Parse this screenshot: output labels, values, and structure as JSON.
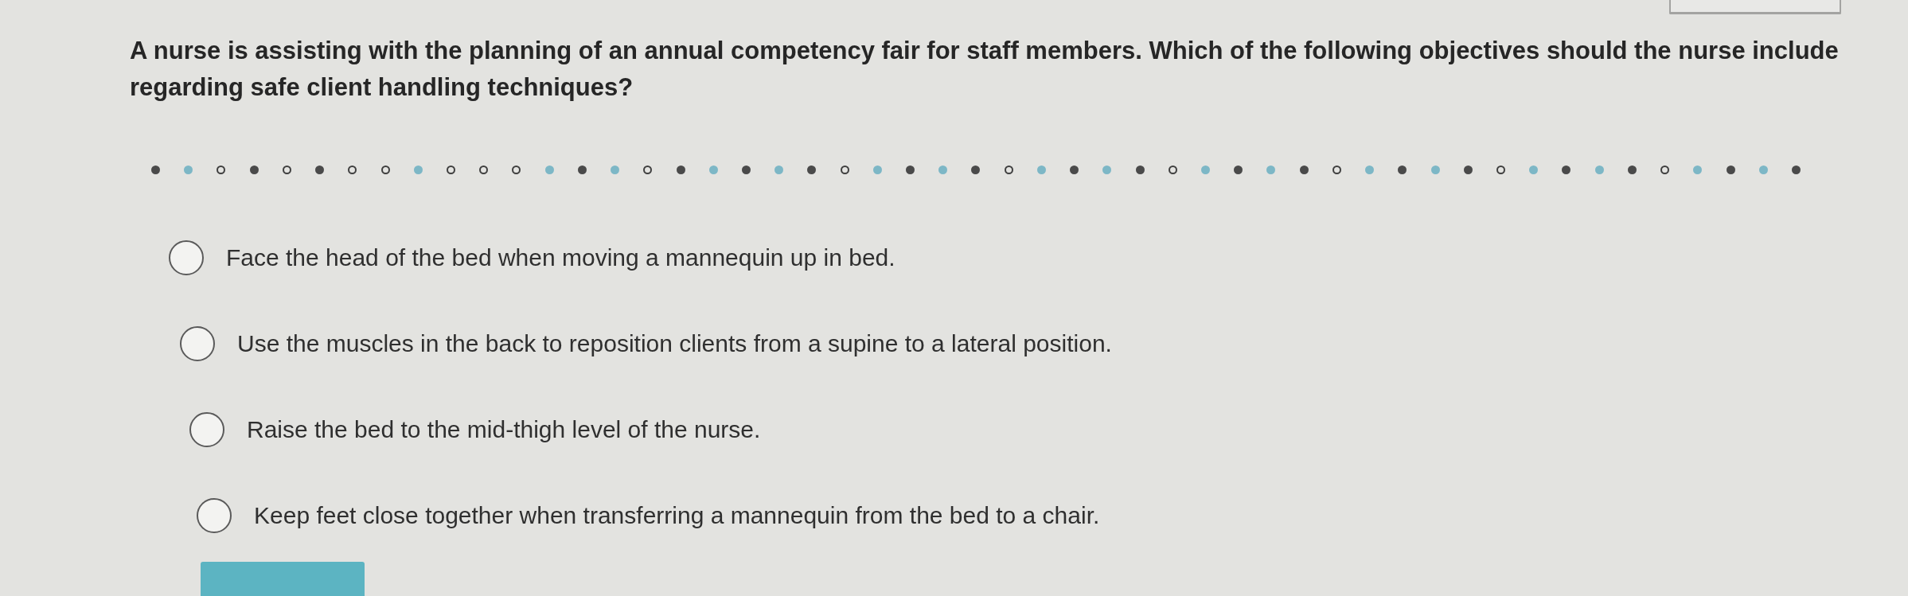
{
  "question": {
    "text": "A nurse is assisting with the planning of an annual competency fair for staff members. Which of the following objectives should the nurse include regarding safe client handling techniques?"
  },
  "progress_dots": [
    {
      "kind": "filled"
    },
    {
      "kind": "tinted"
    },
    {
      "kind": "hollow"
    },
    {
      "kind": "filled"
    },
    {
      "kind": "hollow"
    },
    {
      "kind": "filled"
    },
    {
      "kind": "hollow"
    },
    {
      "kind": "hollow"
    },
    {
      "kind": "tinted"
    },
    {
      "kind": "hollow"
    },
    {
      "kind": "hollow"
    },
    {
      "kind": "hollow"
    },
    {
      "kind": "tinted"
    },
    {
      "kind": "filled"
    },
    {
      "kind": "tinted"
    },
    {
      "kind": "hollow"
    },
    {
      "kind": "filled"
    },
    {
      "kind": "tinted"
    },
    {
      "kind": "filled"
    },
    {
      "kind": "tinted"
    },
    {
      "kind": "filled"
    },
    {
      "kind": "hollow"
    },
    {
      "kind": "tinted"
    },
    {
      "kind": "filled"
    },
    {
      "kind": "tinted"
    },
    {
      "kind": "filled"
    },
    {
      "kind": "hollow"
    },
    {
      "kind": "tinted"
    },
    {
      "kind": "filled"
    },
    {
      "kind": "tinted"
    },
    {
      "kind": "filled"
    },
    {
      "kind": "hollow"
    },
    {
      "kind": "tinted"
    },
    {
      "kind": "filled"
    },
    {
      "kind": "tinted"
    },
    {
      "kind": "filled"
    },
    {
      "kind": "hollow"
    },
    {
      "kind": "tinted"
    },
    {
      "kind": "filled"
    },
    {
      "kind": "tinted"
    },
    {
      "kind": "filled"
    },
    {
      "kind": "hollow"
    },
    {
      "kind": "tinted"
    },
    {
      "kind": "filled"
    },
    {
      "kind": "tinted"
    },
    {
      "kind": "filled"
    },
    {
      "kind": "hollow"
    },
    {
      "kind": "tinted"
    },
    {
      "kind": "filled"
    },
    {
      "kind": "tinted"
    },
    {
      "kind": "filled"
    }
  ],
  "options": [
    {
      "label": "Face the head of the bed when moving a mannequin up in bed.",
      "selected": false
    },
    {
      "label": "Use the muscles in the back to reposition clients from a supine to a lateral position.",
      "selected": false
    },
    {
      "label": "Raise the bed to the mid-thigh level of the nurse.",
      "selected": false
    },
    {
      "label": "Keep feet close together when transferring a mannequin from the bed to a chair.",
      "selected": false
    }
  ]
}
